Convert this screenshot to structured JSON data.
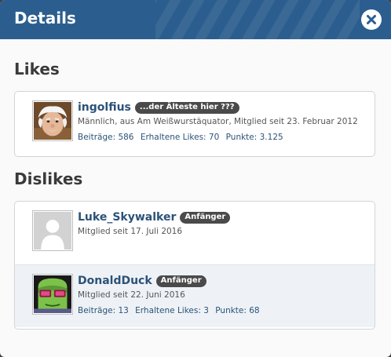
{
  "dialog": {
    "title": "Details",
    "close_icon": "close-icon"
  },
  "likes": {
    "heading": "Likes",
    "members": [
      {
        "username": "ingolfius",
        "banner": "...der Älteste hier ???",
        "blurb": "Männlich, aus Am Weißwurstäquator, Mitglied seit 23. Februar 2012",
        "stats": [
          "Beiträge: 586",
          "Erhaltene Likes: 70",
          "Punkte: 3.125"
        ]
      }
    ]
  },
  "dislikes": {
    "heading": "Dislikes",
    "members": [
      {
        "username": "Luke_Skywalker",
        "banner": "Anfänger",
        "blurb": "Mitglied seit 17. Juli 2016"
      },
      {
        "username": "DonaldDuck",
        "banner": "Anfänger",
        "blurb": "Mitglied seit 22. Juni 2016",
        "stats": [
          "Beiträge: 13",
          "Erhaltene Likes: 3",
          "Punkte: 68"
        ]
      }
    ]
  }
}
